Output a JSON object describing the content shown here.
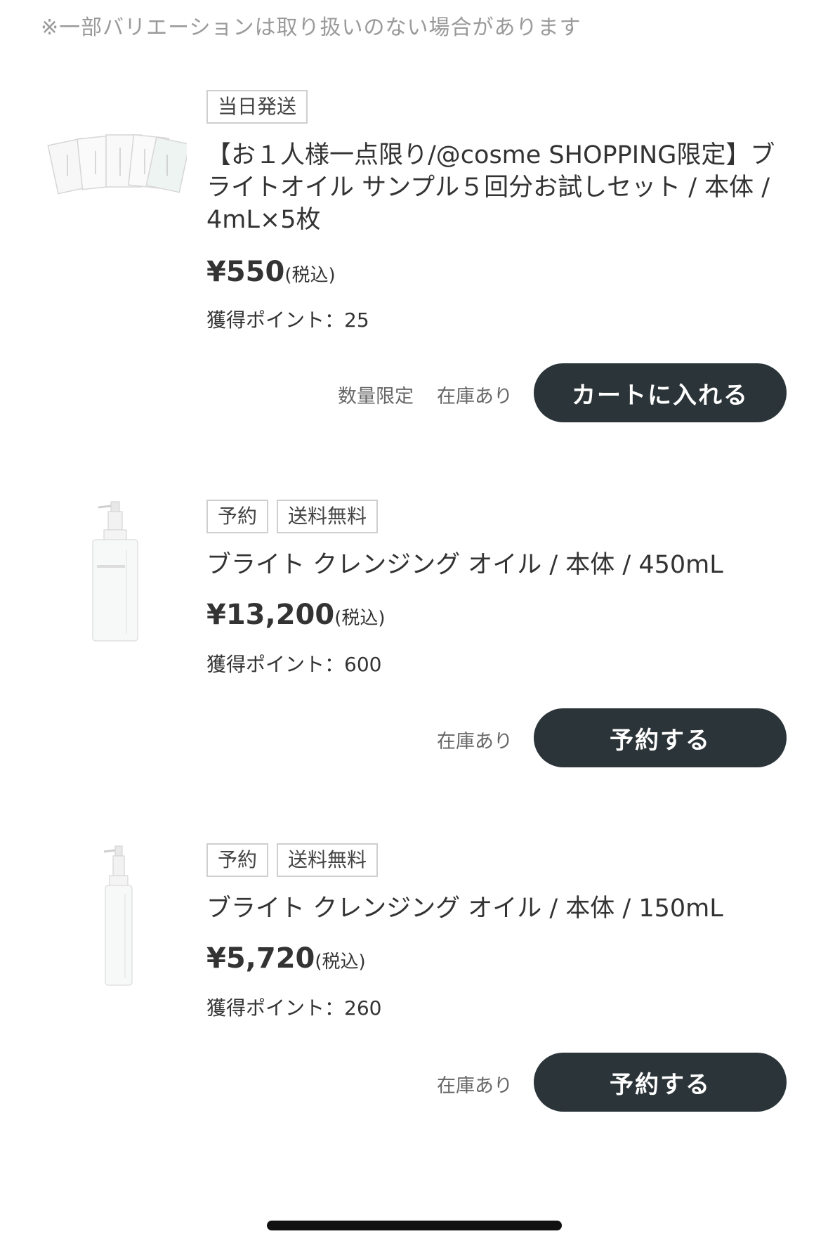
{
  "notice": "※一部バリエーションは取り扱いのない場合があります",
  "products": [
    {
      "image": "sample-sachets-image",
      "tags": [
        "当日発送"
      ],
      "title": "【お１人様一点限り/@cosme SHOPPING限定】ブライトオイル サンプル５回分お試しセット / 本体 / 4mL×5枚",
      "price": "¥550",
      "tax_label": "(税込)",
      "points": "獲得ポイント：25",
      "limited_label": "数量限定",
      "stock_label": "在庫あり",
      "button_label": "カートに入れる"
    },
    {
      "image": "cleansing-oil-bottle-450ml-image",
      "tags": [
        "予約",
        "送料無料"
      ],
      "title": "ブライト クレンジング オイル / 本体 / 450mL",
      "price": "¥13,200",
      "tax_label": "(税込)",
      "points": "獲得ポイント：600",
      "stock_label": "在庫あり",
      "button_label": "予約する"
    },
    {
      "image": "cleansing-oil-bottle-150ml-image",
      "tags": [
        "予約",
        "送料無料"
      ],
      "title": "ブライト クレンジング オイル / 本体 / 150mL",
      "price": "¥5,720",
      "tax_label": "(税込)",
      "points": "獲得ポイント：260",
      "stock_label": "在庫あり",
      "button_label": "予約する"
    }
  ],
  "colors": {
    "button_bg": "#2b3438",
    "button_text": "#ffffff",
    "tag_border": "#cfcfcf",
    "notice_text": "#9a9a9a"
  }
}
